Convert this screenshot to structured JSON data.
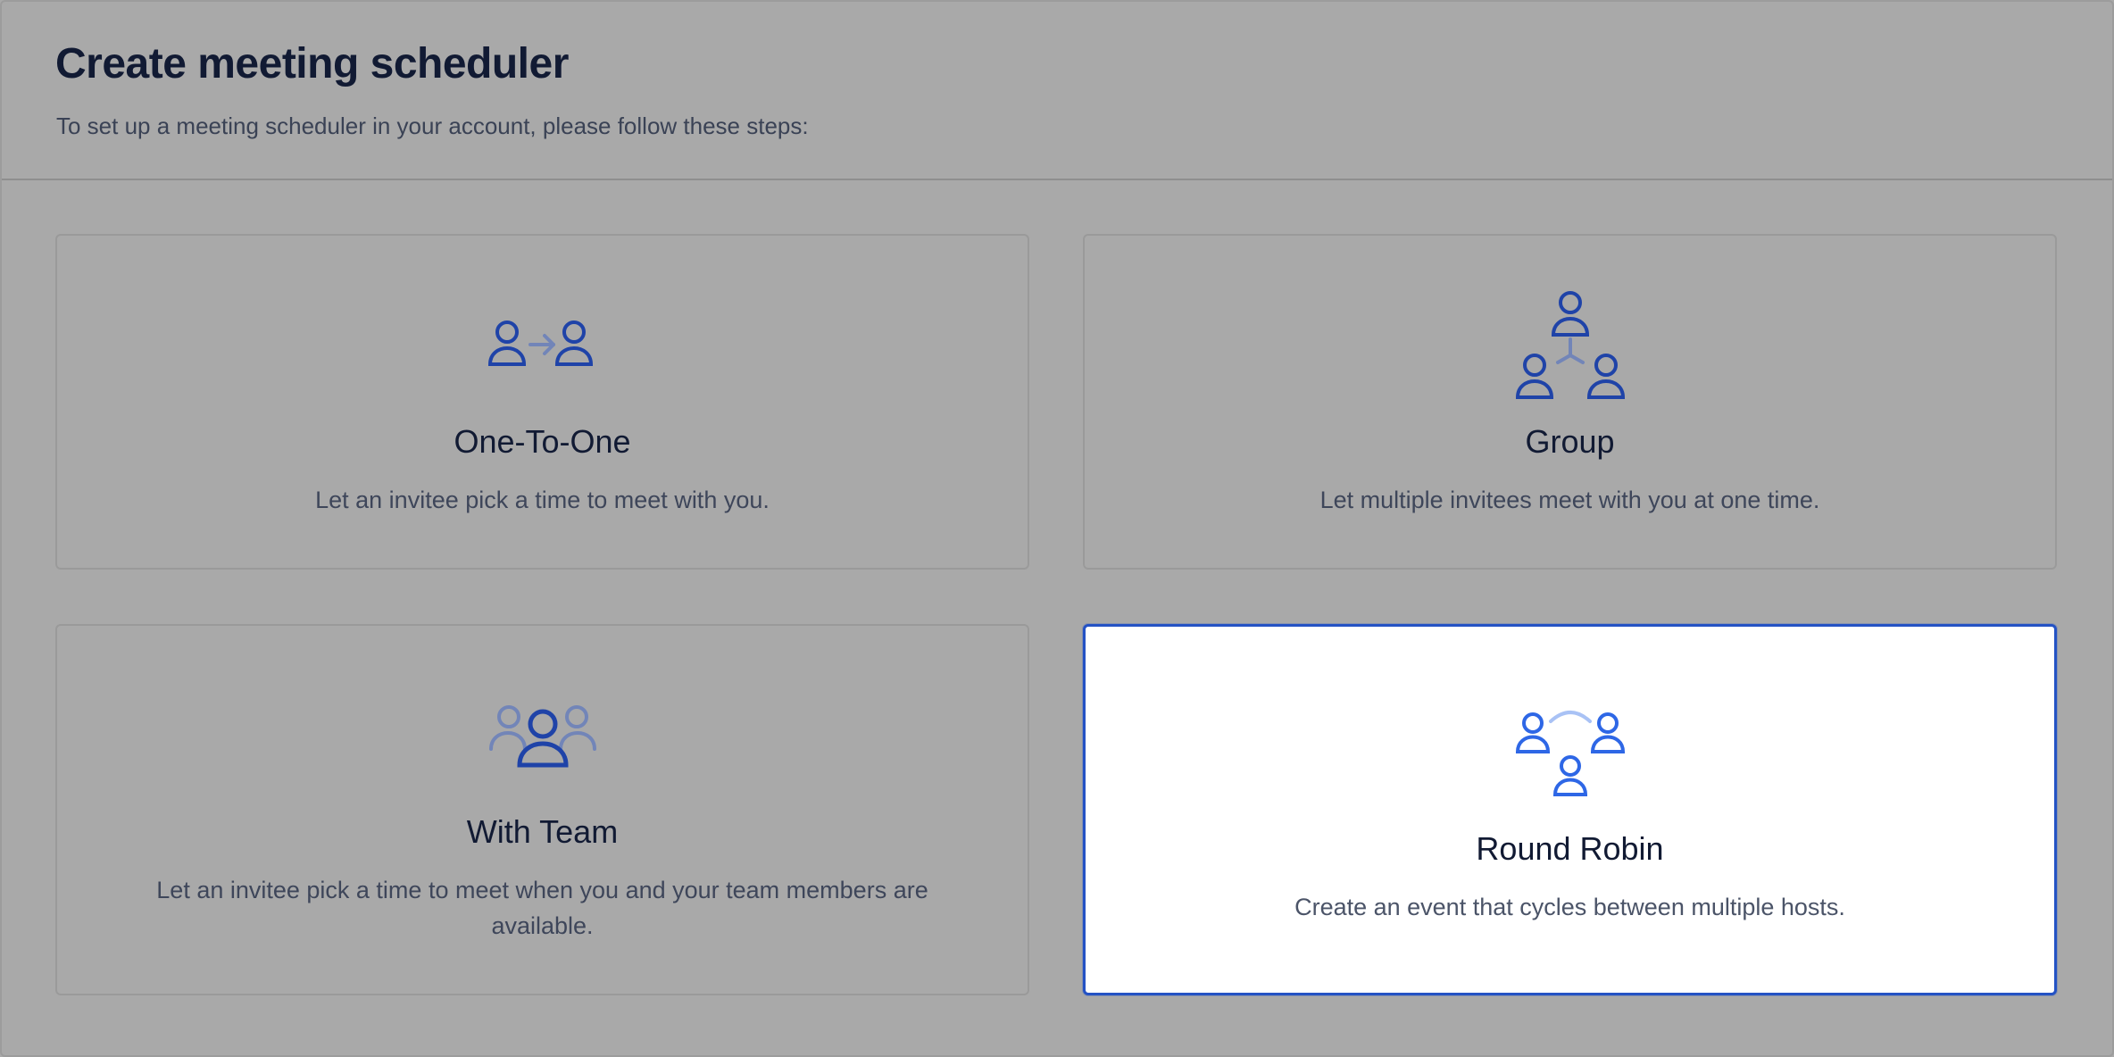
{
  "header": {
    "title": "Create meeting scheduler",
    "subtitle": "To set up a meeting scheduler in your account, please follow these steps:"
  },
  "options": [
    {
      "label": "One-To-One",
      "description": "Let an invitee pick a time to meet with you.",
      "icon": "one-to-one-icon",
      "selected": false
    },
    {
      "label": "Group",
      "description": "Let multiple invitees meet with you at one time.",
      "icon": "group-icon",
      "selected": false
    },
    {
      "label": "With Team",
      "description": "Let an invitee pick a time to meet when you and your team members are available.",
      "icon": "team-icon",
      "selected": false
    },
    {
      "label": "Round Robin",
      "description": "Create an event that cycles between multiple hosts.",
      "icon": "round-robin-icon",
      "selected": true
    }
  ],
  "colors": {
    "icon_dark": "#1f43a8",
    "icon_light": "#7285b8",
    "icon_selected": "#2e67e6",
    "icon_selected_light": "#a9c2f5",
    "selected_border": "#2452c4",
    "title": "#111a33",
    "overlay": "#a9a9a9"
  }
}
